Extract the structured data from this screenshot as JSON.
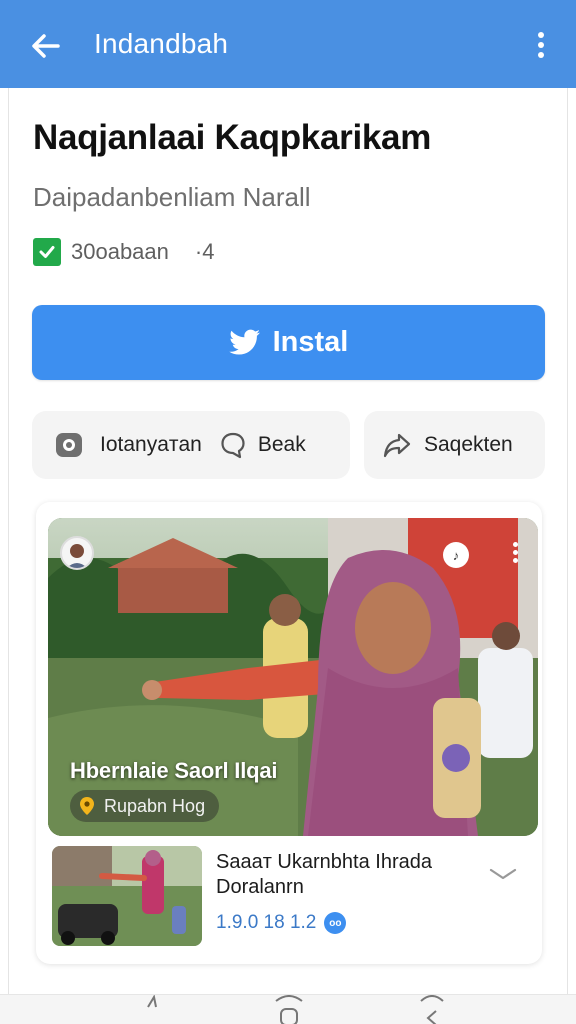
{
  "appbar": {
    "title": "Indandbah",
    "back_icon": "arrow-left-icon",
    "menu_icon": "more-vertical-icon",
    "color": "#4a90e2"
  },
  "app": {
    "name": "Naqjanlaai Kaqpkarikam",
    "developer": "Daipadanbenliam Narall",
    "verified_icon": "check-square-icon",
    "downloads": "30oabaan",
    "rating": "·4"
  },
  "install": {
    "label": "Instal",
    "icon": "bird-icon",
    "color": "#3d8ff0"
  },
  "actions": [
    {
      "label": "Iotanyaтan",
      "icon": "chat-bubble-icon"
    },
    {
      "label": "Beak",
      "icon": "comment-icon"
    },
    {
      "label": "Saqekten",
      "icon": "share-icon"
    }
  ],
  "feature": {
    "caption": "Hbernlaie Saorl Ilqai",
    "location": "Rupabn Hog",
    "location_icon": "pin-icon"
  },
  "related": {
    "title": "Saaaт Ukarnbhta Ihrada Doralanrn",
    "meta": "1.9.0 18 1.2",
    "badge": "oo"
  }
}
